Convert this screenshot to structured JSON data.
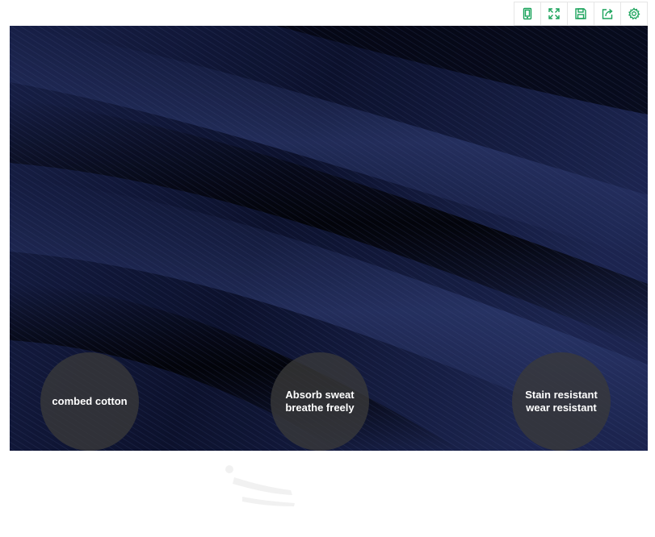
{
  "toolbar": {
    "buttons": [
      {
        "icon": "tablet-icon"
      },
      {
        "icon": "expand-icon"
      },
      {
        "icon": "save-icon"
      },
      {
        "icon": "share-icon"
      },
      {
        "icon": "gear-icon"
      }
    ],
    "accent_color": "#1aa35b"
  },
  "features": [
    {
      "lines": [
        "combed cotton"
      ]
    },
    {
      "lines": [
        "Absorb sweat",
        "breathe freely"
      ]
    },
    {
      "lines": [
        "Stain resistant",
        "wear resistant"
      ]
    }
  ]
}
